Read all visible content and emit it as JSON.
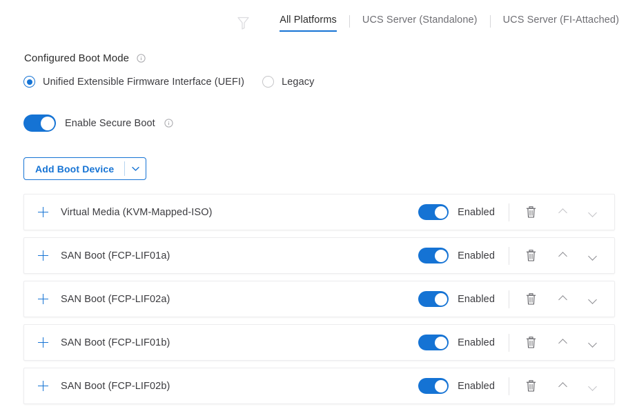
{
  "header": {
    "filter_icon": "filter-funnel-icon",
    "tabs": [
      {
        "label": "All Platforms",
        "active": true
      },
      {
        "label": "UCS Server (Standalone)",
        "active": false
      },
      {
        "label": "UCS Server (FI-Attached)",
        "active": false
      }
    ]
  },
  "boot_mode": {
    "title": "Configured Boot Mode",
    "info_icon": "info-circle-icon",
    "options": [
      {
        "label": "Unified Extensible Firmware Interface (UEFI)",
        "selected": true
      },
      {
        "label": "Legacy",
        "selected": false
      }
    ]
  },
  "secure_boot": {
    "label": "Enable Secure Boot",
    "enabled": true,
    "info_icon": "info-circle-icon"
  },
  "add_boot_device": {
    "label": "Add Boot Device",
    "caret_icon": "chevron-down-icon"
  },
  "device_list": {
    "status_label": "Enabled",
    "delete_icon": "trash-icon",
    "move_up_icon": "chevron-up-icon",
    "move_down_icon": "chevron-down-icon",
    "expand_icon": "plus-icon",
    "rows": [
      {
        "name": "Virtual Media (KVM-Mapped-ISO)",
        "enabled": true
      },
      {
        "name": "SAN Boot (FCP-LIF01a)",
        "enabled": true
      },
      {
        "name": "SAN Boot (FCP-LIF02a)",
        "enabled": true
      },
      {
        "name": "SAN Boot (FCP-LIF01b)",
        "enabled": true
      },
      {
        "name": "SAN Boot (FCP-LIF02b)",
        "enabled": true
      }
    ]
  },
  "colors": {
    "accent": "#1573d4",
    "text": "#3b3b3f",
    "muted": "#6e6e73",
    "border": "#ececee"
  }
}
